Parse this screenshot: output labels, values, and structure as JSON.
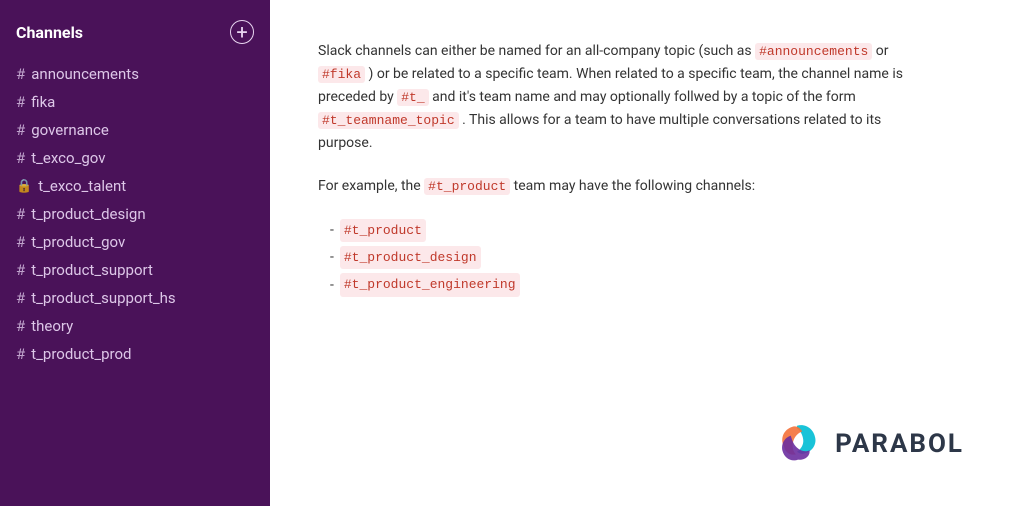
{
  "sidebar": {
    "title": "Channels",
    "add_button_label": "+",
    "channels": [
      {
        "id": "announcements",
        "prefix": "#",
        "name": "announcements",
        "locked": false
      },
      {
        "id": "fika",
        "prefix": "#",
        "name": "fika",
        "locked": false
      },
      {
        "id": "governance",
        "prefix": "#",
        "name": "governance",
        "locked": false
      },
      {
        "id": "t_exco_gov",
        "prefix": "#",
        "name": "t_exco_gov",
        "locked": false
      },
      {
        "id": "t_exco_talent",
        "prefix": "🔒",
        "name": "t_exco_talent",
        "locked": true
      },
      {
        "id": "t_product_design",
        "prefix": "#",
        "name": "t_product_design",
        "locked": false
      },
      {
        "id": "t_product_gov",
        "prefix": "#",
        "name": "t_product_gov",
        "locked": false
      },
      {
        "id": "t_product_support",
        "prefix": "#",
        "name": "t_product_support",
        "locked": false
      },
      {
        "id": "t_product_support_hs",
        "prefix": "#",
        "name": "t_product_support_hs",
        "locked": false
      },
      {
        "id": "theory",
        "prefix": "#",
        "name": "theory",
        "locked": false
      },
      {
        "id": "t_product_prod",
        "prefix": "#",
        "name": "t_product_prod",
        "locked": false
      }
    ]
  },
  "main": {
    "paragraph1_before1": "Slack channels can either be named for an all-company topic (such as ",
    "code1": "#announcements",
    "paragraph1_between": " or ",
    "code2": "#fika",
    "paragraph1_after": " ) or be related to a specific team. When related to a specific team, the channel name is preceded by",
    "code3": "#t_",
    "paragraph1_after2": " and it's team name and may optionally follwed by a topic of the form ",
    "code4": "#t_teamname_topic",
    "paragraph1_after3": " . This allows for a team to have multiple conversations related to its purpose.",
    "paragraph2_before": "For example, the ",
    "code5": "#t_product",
    "paragraph2_after": " team may have the following channels:",
    "examples": [
      "#t_product",
      "#t_product_design",
      "#t_product_engineering"
    ]
  },
  "logo": {
    "text": "PARABOL"
  }
}
